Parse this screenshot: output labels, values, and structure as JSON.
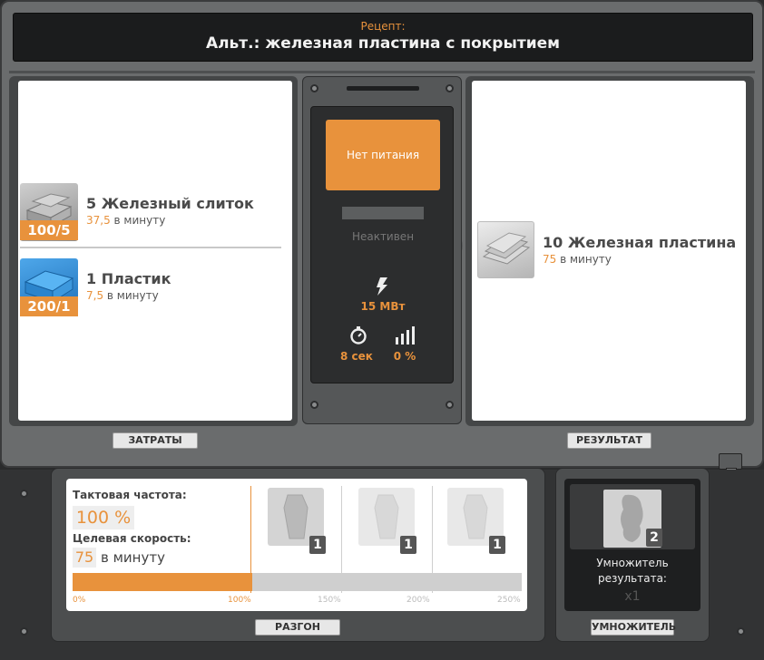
{
  "header": {
    "label": "Рецепт:",
    "title": "Альт.: железная пластина с покрытием"
  },
  "inputs": [
    {
      "name": "5 Железный слиток",
      "rate": "37,5",
      "rate_unit": "в минуту",
      "stack": "100/5",
      "icon": "iron-ingot-icon"
    },
    {
      "name": "1 Пластик",
      "rate": "7,5",
      "rate_unit": "в минуту",
      "stack": "200/1",
      "icon": "plastic-icon"
    }
  ],
  "output": {
    "name": "10 Железная пластина",
    "rate": "75",
    "rate_unit": "в минуту",
    "icon": "iron-plate-icon"
  },
  "machine": {
    "power_button": "Нет питания",
    "status": "Неактивен",
    "power": "15 МВт",
    "cycle_time": "8 сек",
    "productivity": "0 %"
  },
  "footer": {
    "inputs_label": "ЗАТРАТЫ",
    "output_label": "РЕЗУЛЬТАТ"
  },
  "overclock": {
    "clock_label": "Тактовая частота:",
    "clock_value": "100 %",
    "target_label": "Целевая скорость:",
    "target_value": "75",
    "target_unit": "в минуту",
    "slots": [
      "1",
      "1",
      "1"
    ],
    "ticks": [
      "0%",
      "100%",
      "150%",
      "200%",
      "250%"
    ],
    "fill_fraction": 0.4,
    "button": "РАЗГОН"
  },
  "multiplier": {
    "count": "2",
    "label": "Умножитель результата:",
    "value": "x1",
    "button": "УМНОЖИТЕЛЬ"
  },
  "colors": {
    "accent": "#e8923c",
    "panel": "#444647",
    "frame": "#6a6c6d"
  }
}
